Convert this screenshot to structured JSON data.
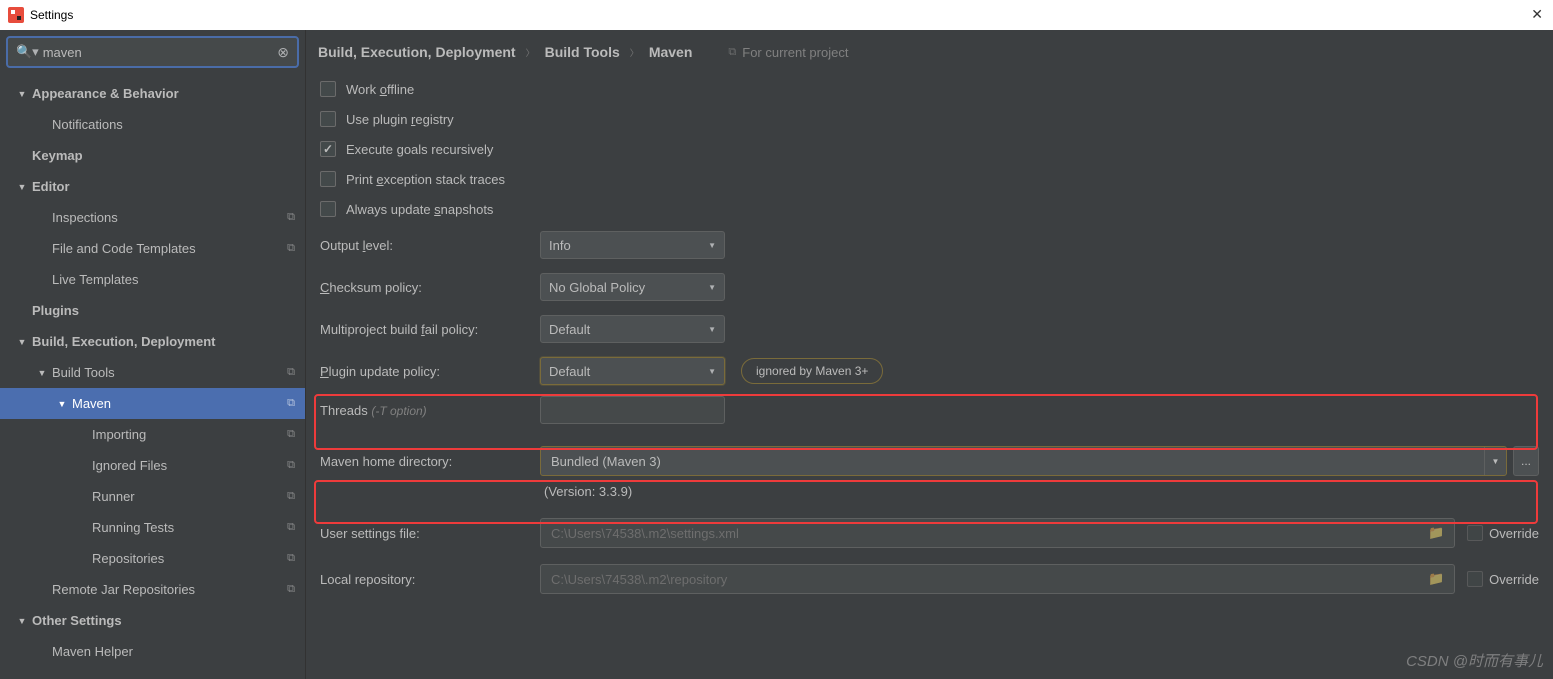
{
  "window": {
    "title": "Settings"
  },
  "search": {
    "value": "maven"
  },
  "sidebar": {
    "items": [
      {
        "label": "Appearance & Behavior",
        "indent": 0,
        "bold": true,
        "chev": true,
        "copy": false
      },
      {
        "label": "Notifications",
        "indent": 1,
        "bold": false,
        "chev": false,
        "copy": false
      },
      {
        "label": "Keymap",
        "indent": 0,
        "bold": true,
        "chev": false,
        "copy": false
      },
      {
        "label": "Editor",
        "indent": 0,
        "bold": true,
        "chev": true,
        "copy": false
      },
      {
        "label": "Inspections",
        "indent": 1,
        "bold": false,
        "chev": false,
        "copy": true
      },
      {
        "label": "File and Code Templates",
        "indent": 1,
        "bold": false,
        "chev": false,
        "copy": true
      },
      {
        "label": "Live Templates",
        "indent": 1,
        "bold": false,
        "chev": false,
        "copy": false
      },
      {
        "label": "Plugins",
        "indent": 0,
        "bold": true,
        "chev": false,
        "copy": false
      },
      {
        "label": "Build, Execution, Deployment",
        "indent": 0,
        "bold": true,
        "chev": true,
        "copy": false
      },
      {
        "label": "Build Tools",
        "indent": 1,
        "bold": false,
        "chev": true,
        "copy": true
      },
      {
        "label": "Maven",
        "indent": 2,
        "bold": false,
        "chev": true,
        "copy": true,
        "selected": true
      },
      {
        "label": "Importing",
        "indent": 3,
        "bold": false,
        "chev": false,
        "copy": true
      },
      {
        "label": "Ignored Files",
        "indent": 3,
        "bold": false,
        "chev": false,
        "copy": true
      },
      {
        "label": "Runner",
        "indent": 3,
        "bold": false,
        "chev": false,
        "copy": true
      },
      {
        "label": "Running Tests",
        "indent": 3,
        "bold": false,
        "chev": false,
        "copy": true
      },
      {
        "label": "Repositories",
        "indent": 3,
        "bold": false,
        "chev": false,
        "copy": true
      },
      {
        "label": "Remote Jar Repositories",
        "indent": 1,
        "bold": false,
        "chev": false,
        "copy": true
      },
      {
        "label": "Other Settings",
        "indent": 0,
        "bold": true,
        "chev": true,
        "copy": false
      },
      {
        "label": "Maven Helper",
        "indent": 1,
        "bold": false,
        "chev": false,
        "copy": false
      }
    ]
  },
  "breadcrumb": {
    "items": [
      "Build, Execution, Deployment",
      "Build Tools",
      "Maven"
    ],
    "project_hint": "For current project"
  },
  "checks": {
    "work_offline": "Work offline",
    "plugin_registry": "Use plugin registry",
    "execute_recursive": "Execute goals recursively",
    "exception_trace": "Print exception stack traces",
    "update_snapshots": "Always update snapshots"
  },
  "fields": {
    "output_level": {
      "label": "Output level:",
      "value": "Info"
    },
    "checksum": {
      "label": "Checksum policy:",
      "value": "No Global Policy"
    },
    "multiproject": {
      "label": "Multiproject build fail policy:",
      "value": "Default"
    },
    "plugin_update": {
      "label": "Plugin update policy:",
      "value": "Default",
      "pill": "ignored by Maven 3+"
    },
    "threads": {
      "label": "Threads",
      "hint": "(-T option)",
      "value": ""
    },
    "maven_home": {
      "label": "Maven home directory:",
      "value": "Bundled (Maven 3)"
    },
    "version": "(Version: 3.3.9)",
    "user_settings": {
      "label": "User settings file:",
      "value": "C:\\Users\\74538\\.m2\\settings.xml",
      "override": "Override"
    },
    "local_repo": {
      "label": "Local repository:",
      "value": "C:\\Users\\74538\\.m2\\repository",
      "override": "Override"
    }
  },
  "watermark": "CSDN @时而有事儿"
}
